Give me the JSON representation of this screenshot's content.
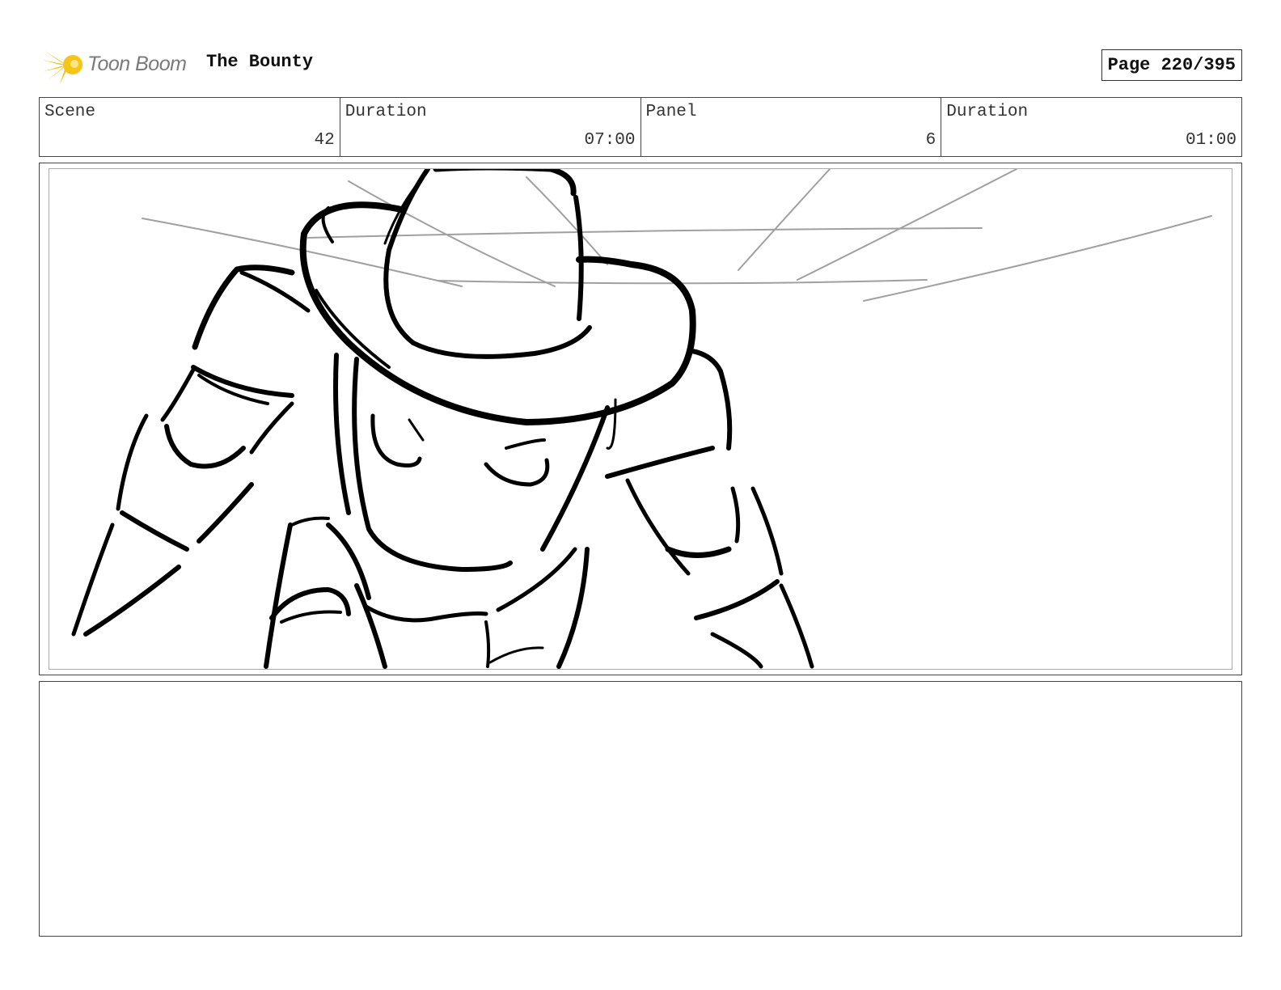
{
  "header": {
    "logo_text": "Toon Boom",
    "project_title": "The Bounty",
    "page_label": "Page 220/395"
  },
  "info": {
    "scene_label": "Scene",
    "scene_value": "42",
    "scene_duration_label": "Duration",
    "scene_duration_value": "07:00",
    "panel_label": "Panel",
    "panel_value": "6",
    "panel_duration_label": "Duration",
    "panel_duration_value": "01:00"
  },
  "colors": {
    "logo_accent": "#f5c518",
    "sketch_line": "#000000",
    "guide_line": "#a0a0a0"
  },
  "notes": {
    "text": ""
  }
}
